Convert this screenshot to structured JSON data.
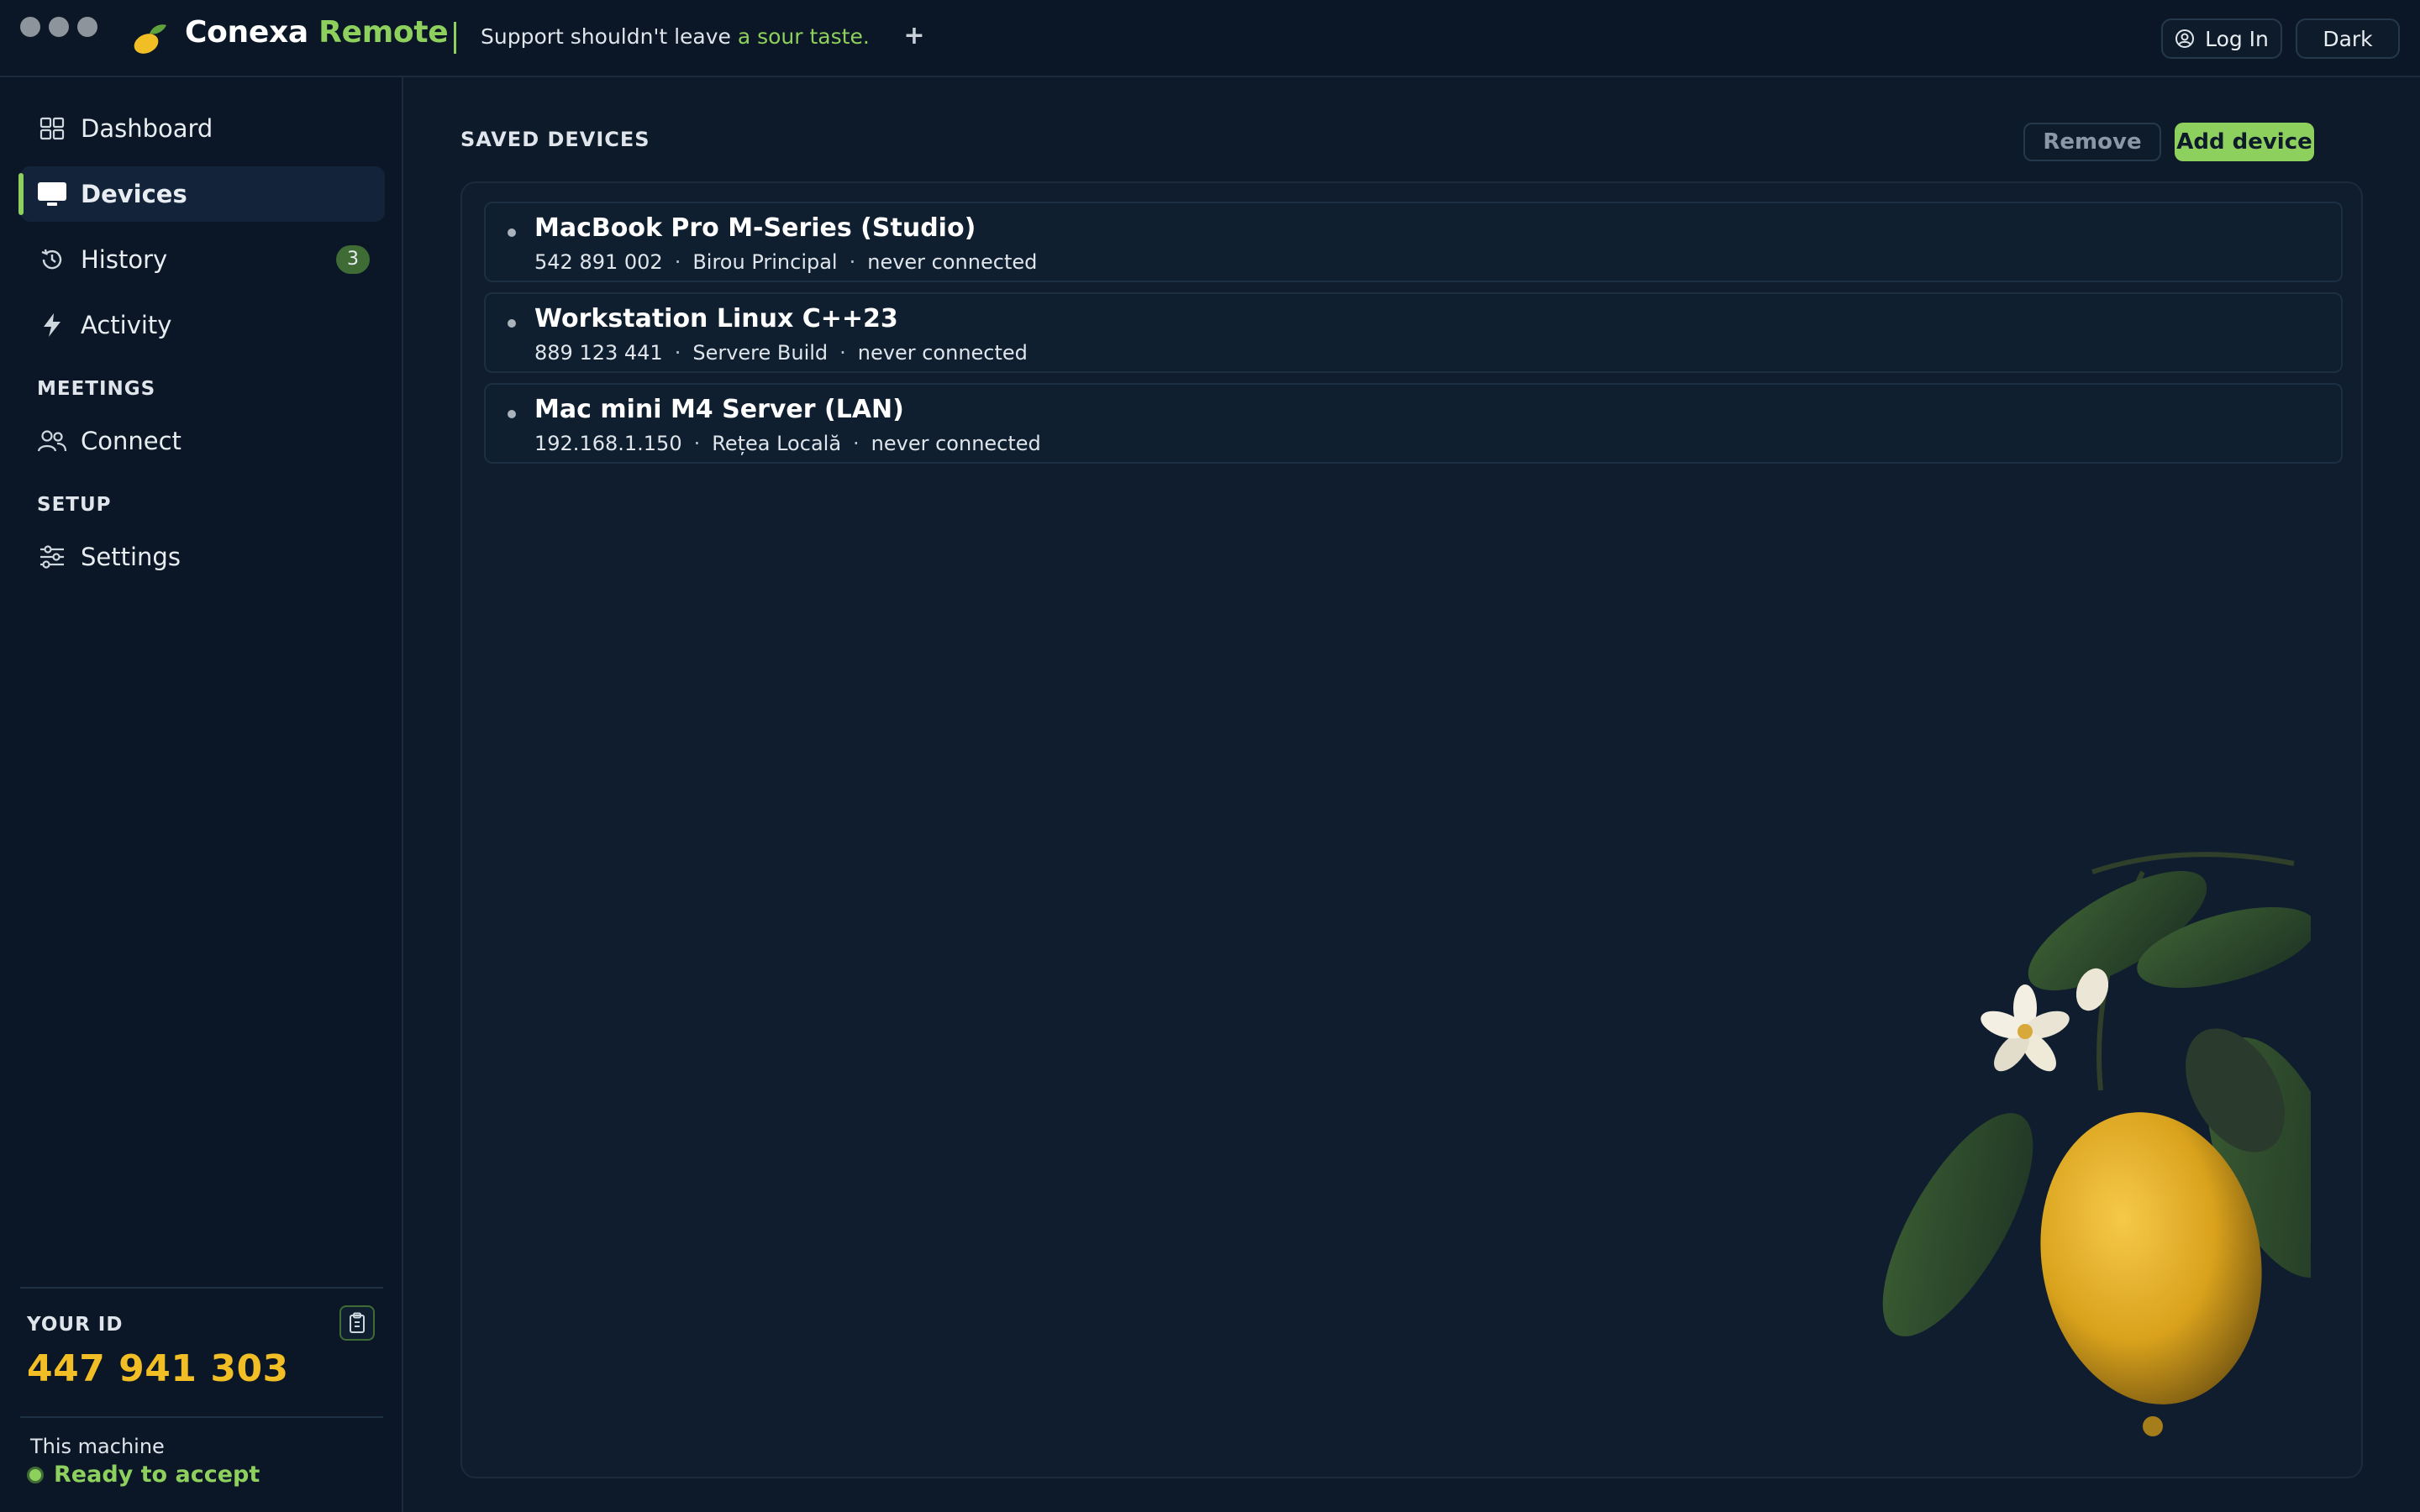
{
  "window": {
    "brand_primary": "Conexa",
    "brand_accent": "Remote",
    "tagline_prefix": "Support shouldn't leave",
    "tagline_accent": "a sour taste.",
    "new_tab_label": "+",
    "login_label": "Log In",
    "theme_label": "Dark"
  },
  "sidebar": {
    "items": [
      {
        "label": "Dashboard",
        "icon": "grid-icon"
      },
      {
        "label": "Devices",
        "icon": "monitor-icon",
        "active": true
      },
      {
        "label": "History",
        "icon": "history-icon",
        "badge": "3"
      },
      {
        "label": "Activity",
        "icon": "bolt-icon"
      }
    ],
    "meetings_label": "MEETINGS",
    "meetings_items": [
      {
        "label": "Connect",
        "icon": "people-icon"
      }
    ],
    "setup_label": "SETUP",
    "setup_items": [
      {
        "label": "Settings",
        "icon": "sliders-icon"
      }
    ],
    "your_id_label": "YOUR ID",
    "your_id_value": "447 941 303",
    "machine_label": "This machine",
    "status_text": "Ready to accept"
  },
  "main": {
    "section_title": "SAVED DEVICES",
    "remove_label": "Remove",
    "add_label": "Add device",
    "devices": [
      {
        "name": "MacBook Pro M-Series (Studio)",
        "id": "542 891 002",
        "group": "Birou Principal",
        "status": "never connected"
      },
      {
        "name": "Workstation Linux C++23",
        "id": "889 123 441",
        "group": "Servere Build",
        "status": "never connected"
      },
      {
        "name": "Mac mini M4 Server (LAN)",
        "id": "192.168.1.150",
        "group": "Rețea Locală",
        "status": "never connected"
      }
    ],
    "separator": "·"
  },
  "colors": {
    "accent": "#8ed05e",
    "id_yellow": "#f2be26",
    "background": "#0d1a2a"
  }
}
